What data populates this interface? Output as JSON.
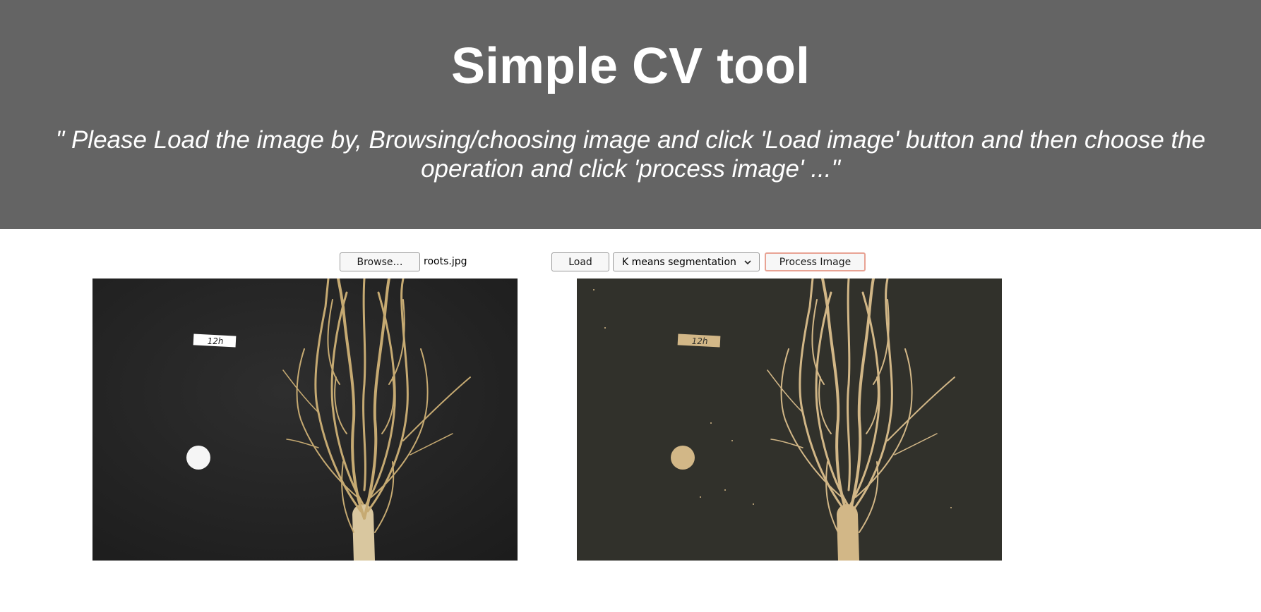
{
  "header": {
    "title": "Simple CV tool",
    "subtitle": "\" Please Load the image by, Browsing/choosing image and click 'Load image' button and then choose the operation and click 'process image' ...\""
  },
  "controls": {
    "browse_label": "Browse…",
    "file_name": "roots.jpg",
    "load_label": "Load",
    "operation_selected": "K means segmentation",
    "process_label": "Process Image"
  },
  "images": {
    "original_label_text": "12h",
    "processed_label_text": "12h"
  },
  "colors": {
    "header_bg": "#646464",
    "process_border": "#e8a394",
    "root_color": "#c9b07a",
    "segment_color": "#d2b787",
    "segment_bg": "#31312b"
  }
}
